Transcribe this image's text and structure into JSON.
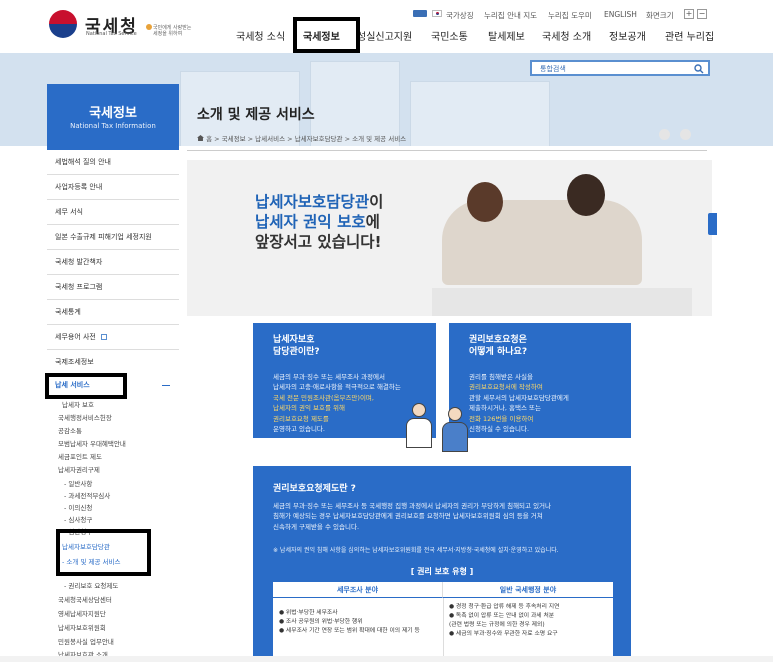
{
  "colors": {
    "primary": "#2a6cc7",
    "visual_bg": "#d3e1ef",
    "highlight": "#ffd966"
  },
  "header": {
    "logo_name": "국세청",
    "logo_sub": "National Tax Service",
    "slogan": [
      "국민에게 사랑받는",
      "세정을 위하여"
    ],
    "utility": [
      "국가상징",
      "누리집 안내 지도",
      "누리집 도우미",
      "ENGLISH",
      "화면크기"
    ],
    "size_plus": "+",
    "size_minus": "−",
    "gnb": [
      "국세청 소식",
      "국세정보",
      "성실신고지원",
      "국민소통",
      "탈세제보",
      "국세청 소개",
      "정보공개",
      "관련 누리집"
    ]
  },
  "search": {
    "value": "통합검색",
    "icon": "search-icon"
  },
  "lnb": {
    "title": "국세정보",
    "subtitle": "National Tax Information",
    "items": [
      "세법해석 질의 안내",
      "사업자등록 안내",
      "세무 서식",
      "일본 수출규제 피해기업 세정지원",
      "국세청 발간책자",
      "국세청 프로그램",
      "국세통계",
      "세무용어 사전",
      "국제조세정보"
    ],
    "open_item": "납세 서비스",
    "open_icon": "minus-icon",
    "sub_items": [
      "납세자 보호",
      "국세행정서비스헌장",
      "공감소통",
      "모범납세자 우대혜택안내",
      "세금포인트 제도",
      "납세자권리구제",
      "- 일반사항",
      "- 과세전적부심사",
      "- 이의신청",
      "- 심사청구",
      "- 심판청구",
      "납세자보호담당관",
      "- 소개 및 제공 서비스",
      "- 권리보호 요청제도",
      "국세청국세상담센터",
      "영세납세자지원단",
      "납세자보호위원회",
      "민원봉사실 업무안내",
      "납세자보호관 소개"
    ]
  },
  "page": {
    "title": "소개 및 제공 서비스",
    "breadcrumb": [
      "홈",
      "국세정보",
      "납세서비스",
      "납세자보호담당관",
      "소개 및 제공 서비스"
    ]
  },
  "banner": {
    "lines": [
      {
        "a": "납세자보호담당관",
        "b": "이"
      },
      {
        "a": "납세자 권익 보호",
        "b": "에"
      },
      {
        "a": "앞장서고 있습니다!",
        "b": ""
      }
    ]
  },
  "box1": {
    "title": [
      "납세자보호",
      "담당관이란?"
    ],
    "body": [
      "세금의 부과·징수 또는 세무조사 과정에서",
      "납세자의 고충·애로사항을 적극적으로 해결하는",
      "국세 전문 민원조사관(옴부즈만)이며,",
      "납세자의 권익 보호를 위해",
      "권리보호요청 제도를",
      "운영하고 있습니다."
    ]
  },
  "box2": {
    "title": [
      "권리보호요청은",
      "어떻게 하나요?"
    ],
    "body": [
      "권리를 침해받은 사실을",
      "권리보호요청서에 작성하여",
      "관할 세무서의 납세자보호담당관에게",
      "제출하시거나, 홈택스 또는",
      "전화 126번을 이용하여",
      "신청하실 수 있습니다."
    ]
  },
  "big": {
    "title": "권리보호요청제도란 ?",
    "body": [
      "세금의 부과·징수 또는 세무조사 등 국세행정 집행 과정에서 납세자의 권리가 부당하게 침해되고 있거나",
      "침해가 예상되는 경우 납세자보호담당관에게 권리보호를 요청하면 납세자보호위원회 심의 등을 거쳐",
      "신속하게 구제받을 수 있습니다."
    ],
    "note": "※ 납세자의 권익 침해 사항을 심의하는 납세자보호위원회를 전국 세무서·지방청·국세청에 설치·운영하고 있습니다.",
    "kind_title": "[ 권리 보호 유형 ]",
    "col1": {
      "head": "세무조사 분야",
      "rows": [
        "● 위법·부당한 세무조사",
        "● 조사 공무원의 위법·부당한 행위",
        "● 세무조사 기간 연장 또는 범위 확대에 대한 이의 제기 등"
      ]
    },
    "col2": {
      "head": "일반 국세행정 분야",
      "rows": [
        "● 경정 청구·환급 압류 해제 등 후속처리 지연",
        "● 독촉 없이 압류 또는 안내 없이 과세 처분",
        "  (관련 법령 또는 규정에 의한 경우 제외)",
        "● 세금의 부과·징수와 무관한 자료 소명 요구"
      ]
    }
  }
}
